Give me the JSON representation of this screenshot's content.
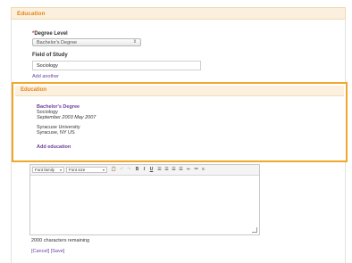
{
  "header": {
    "title": "Education"
  },
  "form": {
    "degree_label": "Degree Level",
    "required_mark": "*",
    "degree_value": "Bachelor's Degree",
    "field_label": "Field of Study",
    "field_value": "Sociology",
    "add_another": "Add another"
  },
  "education_section": {
    "title": "Education",
    "entry": {
      "degree": "Bachelor's Degree",
      "field": "Sociology",
      "dates": "September 2003  May 2007",
      "school": "Syracuse University",
      "location": "Syracuse, NY US"
    },
    "add_education": "Add education"
  },
  "editor": {
    "font_family": "Font family",
    "font_size": "Font size",
    "toolbar_icons": [
      "paste-icon",
      "undo-icon",
      "redo-icon",
      "bold-icon",
      "italic-icon",
      "underline-icon",
      "align-left-icon",
      "align-center-icon",
      "align-right-icon",
      "align-justify-icon",
      "outdent-icon",
      "unordered-list-icon",
      "ordered-list-icon"
    ],
    "chars_remaining": "2000 characters remaining"
  },
  "actions": {
    "cancel": "[Cancel]",
    "save": "[Save]"
  },
  "colors": {
    "accent_orange": "#e2861c",
    "highlight_border": "#f2a62a",
    "link_purple": "#6a3e9e"
  }
}
